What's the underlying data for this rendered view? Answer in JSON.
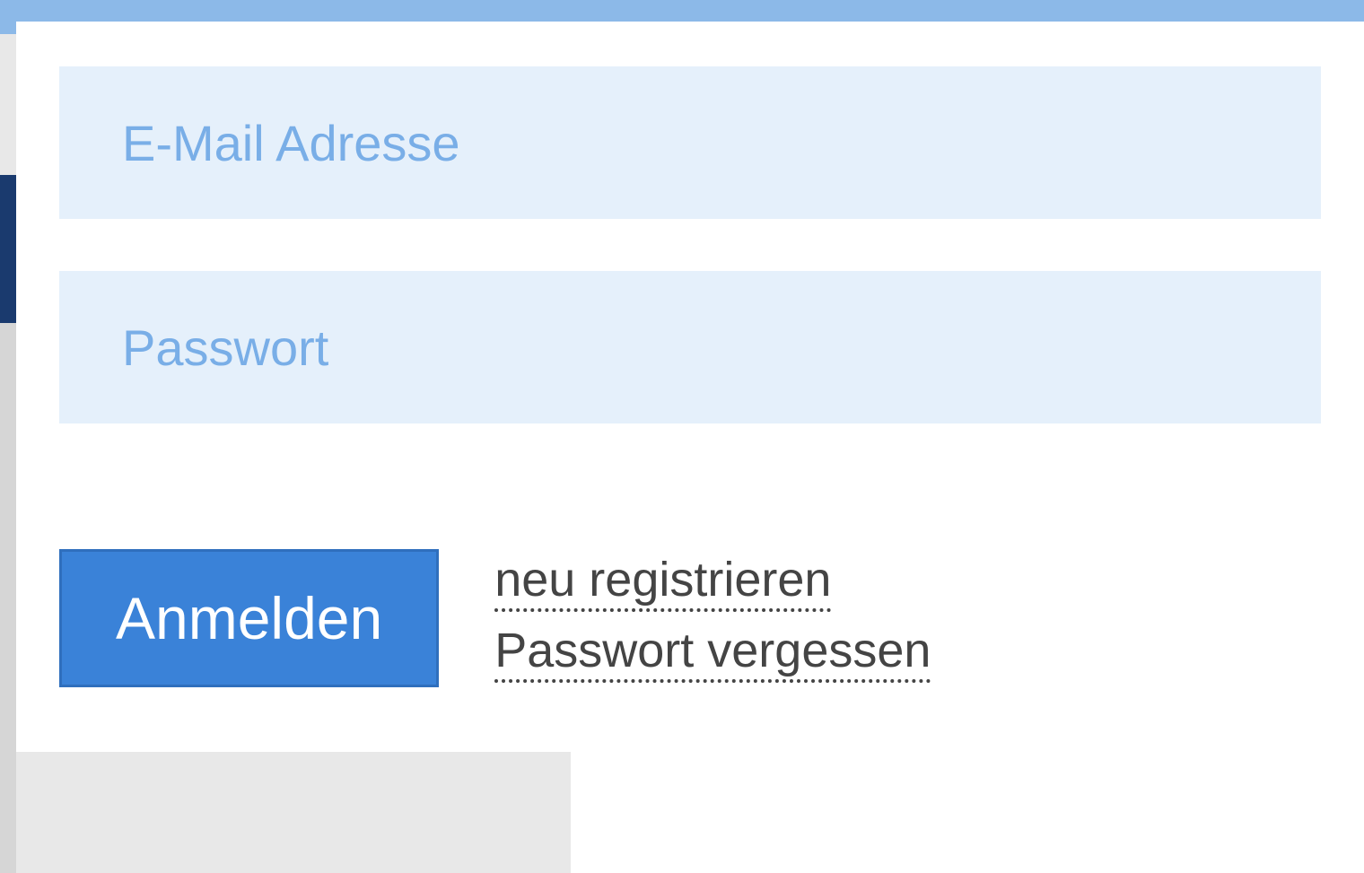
{
  "login": {
    "email_placeholder": "E-Mail Adresse",
    "password_placeholder": "Passwort",
    "submit_label": "Anmelden",
    "register_link": "neu registrieren",
    "forgot_password_link": "Passwort vergessen"
  }
}
